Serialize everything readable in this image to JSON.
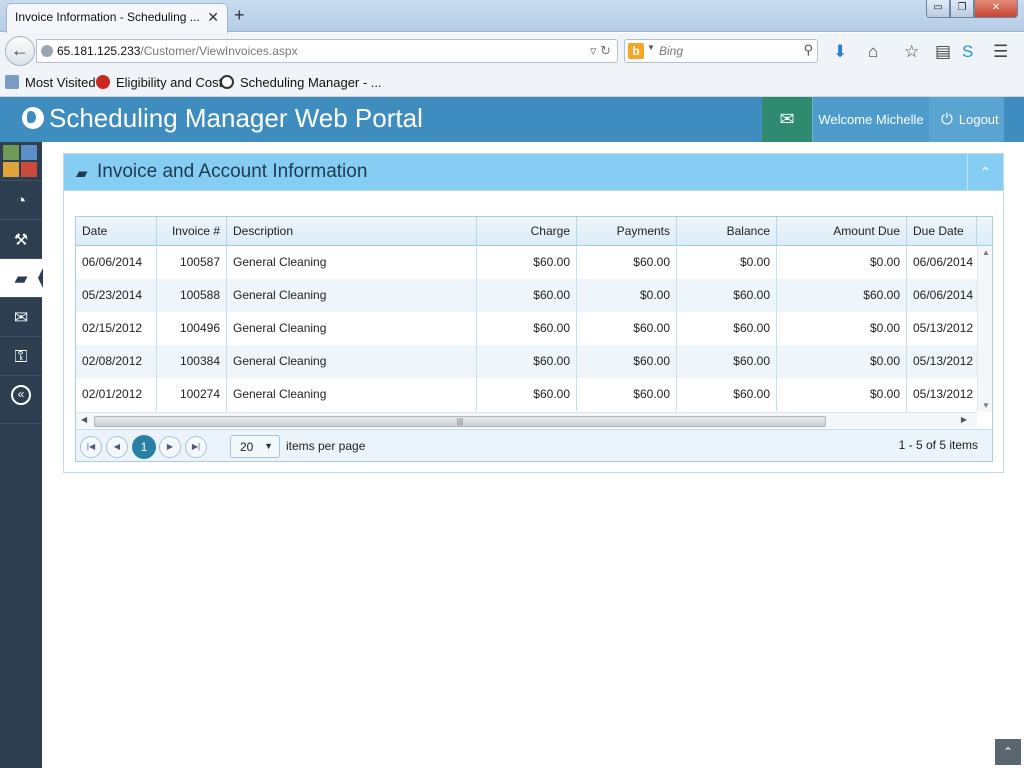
{
  "browser": {
    "tab_title": "Invoice Information - Scheduling ...",
    "tab_close": "✕",
    "new_tab": "+",
    "window_buttons": {
      "minimize": "▭",
      "restore": "❐",
      "close": "✕"
    },
    "url_host": "65.181.125.233",
    "url_path": "/Customer/ViewInvoices.aspx",
    "search_engine": "Bing",
    "search_placeholder": "Bing",
    "bookmarks": [
      "Most Visited",
      "Eligibility and Cost",
      "Scheduling Manager - ..."
    ]
  },
  "app": {
    "title": "Scheduling Manager Web Portal",
    "welcome": "Welcome Michelle",
    "logout": "Logout",
    "brand_color": "#3f8cbf",
    "sidebar_color": "#2c3e50",
    "mail_color": "#2e8b6f",
    "sidebar_items": [
      {
        "icon": "dashboard-icon",
        "glyph": "◔"
      },
      {
        "icon": "gavel-icon",
        "glyph": "🔨"
      },
      {
        "icon": "book-icon",
        "glyph": "📘",
        "active": true
      },
      {
        "icon": "mail-icon",
        "glyph": "✉"
      },
      {
        "icon": "key-icon",
        "glyph": "🔑"
      }
    ]
  },
  "panel": {
    "title": "Invoice and Account Information",
    "toggle": "⌃"
  },
  "grid": {
    "columns": [
      "Date",
      "Invoice #",
      "Description",
      "Charge",
      "Payments",
      "Balance",
      "Amount Due",
      "Due Date"
    ],
    "rows": [
      [
        "06/06/2014",
        "100587",
        "General Cleaning",
        "$60.00",
        "$60.00",
        "$0.00",
        "$0.00",
        "06/06/2014"
      ],
      [
        "05/23/2014",
        "100588",
        "General Cleaning",
        "$60.00",
        "$0.00",
        "$60.00",
        "$60.00",
        "06/06/2014"
      ],
      [
        "02/15/2012",
        "100496",
        "General Cleaning",
        "$60.00",
        "$60.00",
        "$60.00",
        "$0.00",
        "05/13/2012"
      ],
      [
        "02/08/2012",
        "100384",
        "General Cleaning",
        "$60.00",
        "$60.00",
        "$60.00",
        "$0.00",
        "05/13/2012"
      ],
      [
        "02/01/2012",
        "100274",
        "General Cleaning",
        "$60.00",
        "$60.00",
        "$60.00",
        "$0.00",
        "05/13/2012"
      ]
    ]
  },
  "pager": {
    "current_page": "1",
    "page_size": "20",
    "items_per_page_label": "items per page",
    "info": "1 - 5 of 5 items"
  }
}
